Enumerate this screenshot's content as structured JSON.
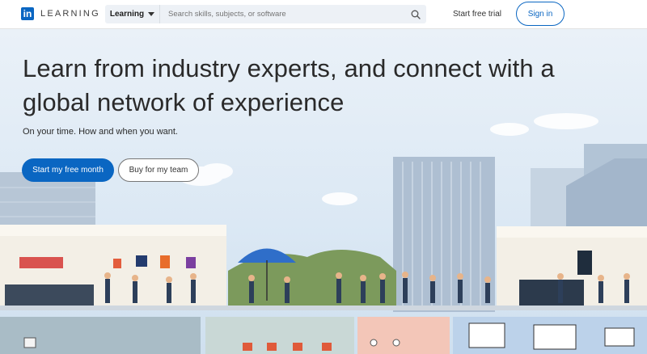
{
  "header": {
    "logo_mark": "in",
    "logo_text": "LEARNING",
    "search_scope": "Learning",
    "search_placeholder": "Search skills, subjects, or software",
    "trial_link": "Start free trial",
    "signin_label": "Sign in"
  },
  "hero": {
    "headline": "Learn from industry experts, and connect with a global network of experience",
    "subtitle": "On your time. How and when you want.",
    "primary_cta": "Start my free month",
    "secondary_cta": "Buy for my team"
  },
  "colors": {
    "brand_blue": "#0a66c2",
    "sky": "#dbe8f4",
    "building": "#a9bbd0"
  },
  "icons": [
    "search-icon",
    "chevron-down-icon",
    "linkedin-logo-icon"
  ]
}
